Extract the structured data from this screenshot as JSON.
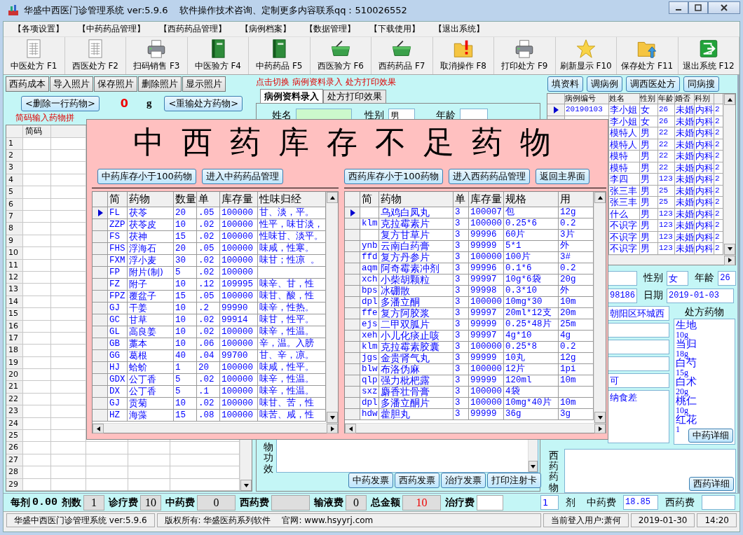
{
  "window": {
    "title": "华盛中西医门诊管理系统 ver:5.9.6    软件操作技术咨询、定制更多内容联系qq：510026552"
  },
  "menu": [
    "【各项设置】",
    "【中药药品管理】",
    "【西药药品管理】",
    "【病例档案】",
    "【数据管理】",
    "【下载使用】",
    "【退出系统】"
  ],
  "toolbar": [
    {
      "label": "中医处方 F1"
    },
    {
      "label": "西医处方 F2"
    },
    {
      "label": "扫码销售 F3"
    },
    {
      "label": "中医验方 F4"
    },
    {
      "label": "中药药品 F5"
    },
    {
      "label": "西医验方 F6"
    },
    {
      "label": "西药药品 F7"
    },
    {
      "label": "取消操作 F8"
    },
    {
      "label": "打印处方 F9"
    },
    {
      "label": "刷新显示 F10"
    },
    {
      "label": "保存处方 F11"
    },
    {
      "label": "退出系统 F12"
    }
  ],
  "left_panel": {
    "buttons": [
      "西药成本",
      "导入照片",
      "保存照片",
      "删除照片",
      "显示照片"
    ],
    "delete_button": "<删除一行药物>",
    "dose_value": "0",
    "dose_unit": "g",
    "reenter_button": "<重输处方药物>",
    "hint": "简码输入药物拼",
    "grid": {
      "column": "简码",
      "row_numbers": [
        "1",
        "2",
        "3",
        "4",
        "5",
        "6",
        "7",
        "8",
        "9",
        "10",
        "11",
        "12",
        "13",
        "14",
        "15",
        "16",
        "17",
        "18",
        "19",
        "20",
        "21",
        "22",
        "23",
        "24",
        "25",
        "26",
        "27",
        "28",
        "29"
      ]
    }
  },
  "middle_panel": {
    "hint": "点击切换 病例资料录入 处方打印效果",
    "tabs": [
      {
        "label": "病例资料录入",
        "selected": true
      },
      {
        "label": "处方打印效果",
        "selected": false
      }
    ],
    "name_label": "姓名",
    "gender_label": "性别",
    "gender_value": "男",
    "age_label": "年龄",
    "effect_label": "物功效",
    "print_buttons": [
      "中药发票",
      "西药发票",
      "治疗发票",
      "打印注射卡"
    ]
  },
  "right_panel": {
    "buttons": [
      "填资料",
      "调病例",
      "调西医处方",
      "同病搜"
    ],
    "cases": {
      "columns": [
        "病例编号",
        "姓名",
        "性别",
        "年龄",
        "婚否",
        "科别"
      ],
      "rows": [
        {
          "id": "20190103",
          "name": "李小姐",
          "gender": "女",
          "age": "26",
          "marital": "未婚",
          "dept": "内科",
          "column_7": "2",
          "selected": true
        },
        {
          "name": "李小姐",
          "gender": "女",
          "age": "26",
          "marital": "未婚",
          "dept": "内科",
          "column_7": "2"
        },
        {
          "name": "模特人",
          "gender": "男",
          "age": "22",
          "marital": "未婚",
          "dept": "内科",
          "column_7": "2"
        },
        {
          "name": "模特人",
          "gender": "男",
          "age": "22",
          "marital": "未婚",
          "dept": "内科",
          "column_7": "2"
        },
        {
          "name": "模特",
          "gender": "男",
          "age": "22",
          "marital": "未婚",
          "dept": "内科",
          "column_7": "2"
        },
        {
          "name": "模特",
          "gender": "男",
          "age": "22",
          "marital": "未婚",
          "dept": "内科",
          "column_7": "2"
        },
        {
          "name": "李四",
          "gender": "男",
          "age": "123",
          "marital": "未婚",
          "dept": "内科",
          "column_7": "2"
        },
        {
          "name": "张三丰",
          "gender": "男",
          "age": "25",
          "marital": "未婚",
          "dept": "内科",
          "column_7": "2"
        },
        {
          "name": "张三丰",
          "gender": "男",
          "age": "25",
          "marital": "未婚",
          "dept": "内科",
          "column_7": "2"
        },
        {
          "name": "什么",
          "gender": "男",
          "age": "123",
          "marital": "未婚",
          "dept": "内科",
          "column_7": "2"
        },
        {
          "name": "不识字",
          "gender": "男",
          "age": "123",
          "marital": "未婚",
          "dept": "内科",
          "column_7": "2"
        },
        {
          "name": "不识字",
          "gender": "男",
          "age": "123",
          "marital": "未婚",
          "dept": "内科",
          "column_7": "2"
        },
        {
          "name": "不识字",
          "gender": "男",
          "age": "123",
          "marital": "未婚",
          "dept": "内科",
          "column_7": "2"
        }
      ]
    },
    "gender_label": "性别",
    "gender": "女",
    "age_label": "年龄",
    "age": "26",
    "id_field": "98186",
    "date_label": "日期",
    "date": "2019-01-03",
    "address": "朝阳区环城西",
    "field_5": "可",
    "complaint": "纳食差",
    "rx_label": "处方药物",
    "rx_items": [
      {
        "name": "生地",
        "dose": "10g"
      },
      {
        "name": "当归",
        "dose": "18g"
      },
      {
        "name": "白芍",
        "dose": "15g"
      },
      {
        "name": "白术",
        "dose": "20g"
      },
      {
        "name": "桃仁",
        "dose": "10g"
      },
      {
        "name": "红花",
        "dose": "1"
      }
    ],
    "tcm_detail_button": "中药详细",
    "western_label": "西药药物",
    "western_detail_button": "西药详细"
  },
  "fees": [
    {
      "label": "每剂",
      "value": "0.00",
      "kind": "plain"
    },
    {
      "label": "剂数",
      "value": "1",
      "kind": "box"
    },
    {
      "label": "诊疗费",
      "value": "10",
      "kind": "box"
    },
    {
      "label": "中药费",
      "value": "0",
      "kind": "wide"
    },
    {
      "label": "西药费",
      "kind": "wide"
    },
    {
      "label": "输液费",
      "value": "0",
      "kind": "box"
    },
    {
      "label": "总金额",
      "value": "10",
      "kind": "total"
    },
    {
      "label": "治疗费",
      "kind": "input"
    }
  ],
  "fees_right": {
    "doses": "1",
    "doses_label": "剂",
    "tcm_label": "中药费",
    "tcm_value": "18.85",
    "western_label": "西药费"
  },
  "status_bar": [
    [
      "华盛中西医门诊管理系统 ver:5.9.6"
    ],
    [
      "版权所有: 华盛医药系列软件",
      "官网: www.hsyyrj.com"
    ],
    [
      "当前登入用户:萧何"
    ],
    [
      "2019-01-30"
    ],
    [
      "14:20"
    ]
  ],
  "dialog": {
    "title": "中西药库存不足药物",
    "tcm_buttons": [
      "中药库存小于100药物",
      "进入中药药品管理"
    ],
    "western_buttons": [
      "西药库存小于100药物",
      "进入西药药品管理",
      "返回主界面"
    ],
    "tcm_table": {
      "columns": [
        "简",
        "药物",
        "数量",
        "单",
        "库存量",
        "性味归经"
      ],
      "rows": [
        {
          "code": "FL",
          "name": "茯苓",
          "qty": "20",
          "price": ".05",
          "stock": "100000",
          "nature": "甘、淡，平。",
          "selected": true
        },
        {
          "code": "ZZP",
          "name": "茯苓皮",
          "qty": "10",
          "price": ".02",
          "stock": "100000",
          "nature": "性平，味甘淡，",
          "selected": false
        },
        {
          "code": "FS",
          "name": "茯神",
          "qty": "15",
          "price": ".02",
          "stock": "100000",
          "nature": "性味甘、淡平。",
          "selected": false
        },
        {
          "code": "FHS",
          "name": "浮海石",
          "qty": "20",
          "price": ".05",
          "stock": "100000",
          "nature": "味咸，性寒。",
          "selected": false
        },
        {
          "code": "FXM",
          "name": "浮小麦",
          "qty": "30",
          "price": ".02",
          "stock": "100000",
          "nature": "味甘；性凉 。",
          "selected": false
        },
        {
          "code": "FP",
          "name": "附片(制)",
          "qty": "5",
          "price": ".02",
          "stock": "100000",
          "selected": false
        },
        {
          "code": "FZ",
          "name": "附子",
          "qty": "10",
          "price": ".12",
          "stock": "109995",
          "nature": "味辛、甘，性",
          "selected": false
        },
        {
          "code": "FPZ",
          "name": "覆盆子",
          "qty": "15",
          "price": ".05",
          "stock": "100000",
          "nature": "味甘、酸，性",
          "selected": false
        },
        {
          "code": "GJ",
          "name": "干姜",
          "qty": "10",
          "price": ".2",
          "stock": "99990",
          "nature": "味辛，性热。",
          "selected": false
        },
        {
          "code": "GC",
          "name": "甘草",
          "qty": "10",
          "price": ".02",
          "stock": "99914",
          "nature": "味甘，性平。",
          "selected": false
        },
        {
          "code": "GL",
          "name": "高良姜",
          "qty": "10",
          "price": ".02",
          "stock": "100000",
          "nature": "味辛，性温。",
          "selected": false
        },
        {
          "code": "GB",
          "name": "藁本",
          "qty": "10",
          "price": ".06",
          "stock": "100000",
          "nature": "辛，温。入膀",
          "selected": false
        },
        {
          "code": "GG",
          "name": "葛根",
          "qty": "40",
          "price": ".04",
          "stock": "99700",
          "nature": "甘、辛，凉。",
          "selected": false
        },
        {
          "code": "HJ",
          "name": "蛤蚧",
          "qty": "1",
          "price": "20",
          "stock": "100000",
          "nature": "味咸，性平。",
          "selected": false
        },
        {
          "code": "GDX",
          "name": "公丁香",
          "qty": "5",
          "price": ".02",
          "stock": "100000",
          "nature": "味辛，性温。",
          "selected": false
        },
        {
          "code": "DX",
          "name": "公丁香",
          "qty": "5",
          "price": ".1",
          "stock": "100000",
          "nature": "味辛，性温。",
          "selected": false
        },
        {
          "code": "GJ",
          "name": "贡菊",
          "qty": "10",
          "price": ".02",
          "stock": "100000",
          "nature": "味甘、苦，性",
          "selected": false
        },
        {
          "code": "HZ",
          "name": "海藻",
          "qty": "15",
          "price": ".08",
          "stock": "100000",
          "nature": "味苦、咸，性",
          "selected": false
        }
      ]
    },
    "western_table": {
      "columns": [
        "简",
        "药物",
        "单",
        "库存量",
        "规格",
        "用"
      ],
      "rows": [
        {
          "name": "乌鸡白凤丸",
          "price": "3",
          "stock": "100007",
          "spec": "包",
          "usage": "12g",
          "selected": true
        },
        {
          "code": "klm",
          "name": "克拉霉素片",
          "price": "3",
          "stock": "100000",
          "spec": "0.25*6",
          "usage": "0.2",
          "selected": false
        },
        {
          "name": "复方甘草片",
          "price": "3",
          "stock": "99996",
          "spec": "60片",
          "usage": "3片",
          "selected": false
        },
        {
          "code": "ynb",
          "name": "云南白药膏",
          "price": "3",
          "stock": "99999",
          "spec": "5*1",
          "usage": "外",
          "selected": false
        },
        {
          "code": "ffd",
          "name": "复方丹参片",
          "price": "3",
          "stock": "100000",
          "spec": "100片",
          "usage": "3#",
          "selected": false
        },
        {
          "code": "aqm",
          "name": "阿奇霉素冲剂",
          "price": "3",
          "stock": "99996",
          "spec": "0.1*6",
          "usage": "0.2",
          "selected": false
        },
        {
          "code": "xch",
          "name": "小柴胡颗粒",
          "price": "3",
          "stock": "99997",
          "spec": "10g*6袋",
          "usage": "20g",
          "selected": false
        },
        {
          "code": "bps",
          "name": "冰硼散",
          "price": "3",
          "stock": "99998",
          "spec": "0.3*10",
          "usage": "外",
          "selected": false
        },
        {
          "code": "dpl",
          "name": "多潘立酮",
          "price": "3",
          "stock": "100000",
          "spec": "10mg*30",
          "usage": "10m",
          "selected": false
        },
        {
          "code": "ffe",
          "name": "复方阿胶浆",
          "price": "3",
          "stock": "99997",
          "spec": "20ml*12支",
          "usage": "20m",
          "selected": false
        },
        {
          "code": "ejs",
          "name": "二甲双胍片",
          "price": "3",
          "stock": "99999",
          "spec": "0.25*48片",
          "usage": "25m",
          "selected": false
        },
        {
          "code": "xeh",
          "name": "小儿化痰止咳",
          "price": "3",
          "stock": "99997",
          "spec": "4g*10",
          "usage": "4g",
          "selected": false
        },
        {
          "code": "klm",
          "name": "克拉霉素胶囊",
          "price": "3",
          "stock": "100000",
          "spec": "0.25*8",
          "usage": "0.2",
          "selected": false
        },
        {
          "code": "jgs",
          "name": "金贵肾气丸",
          "price": "3",
          "stock": "99999",
          "spec": "10丸",
          "usage": "12g",
          "selected": false
        },
        {
          "code": "blw",
          "name": "布洛伪麻",
          "price": "3",
          "stock": "100000",
          "spec": "12片",
          "usage": "1pi",
          "selected": false
        },
        {
          "code": "qlp",
          "name": "强力枇杷露",
          "price": "3",
          "stock": "99999",
          "spec": "120ml",
          "usage": "10m",
          "selected": false
        },
        {
          "code": "sxz",
          "name": "麝香壮骨膏",
          "price": "3",
          "stock": "100000",
          "spec": "4袋",
          "selected": false
        },
        {
          "code": "dpl",
          "name": "多潘立酮片",
          "price": "3",
          "stock": "100000",
          "spec": "10mg*40片",
          "usage": "10m",
          "selected": false
        },
        {
          "code": "hdw",
          "name": "藿胆丸",
          "price": "3",
          "stock": "99999",
          "spec": "36g",
          "usage": "3g",
          "selected": false
        }
      ]
    }
  }
}
